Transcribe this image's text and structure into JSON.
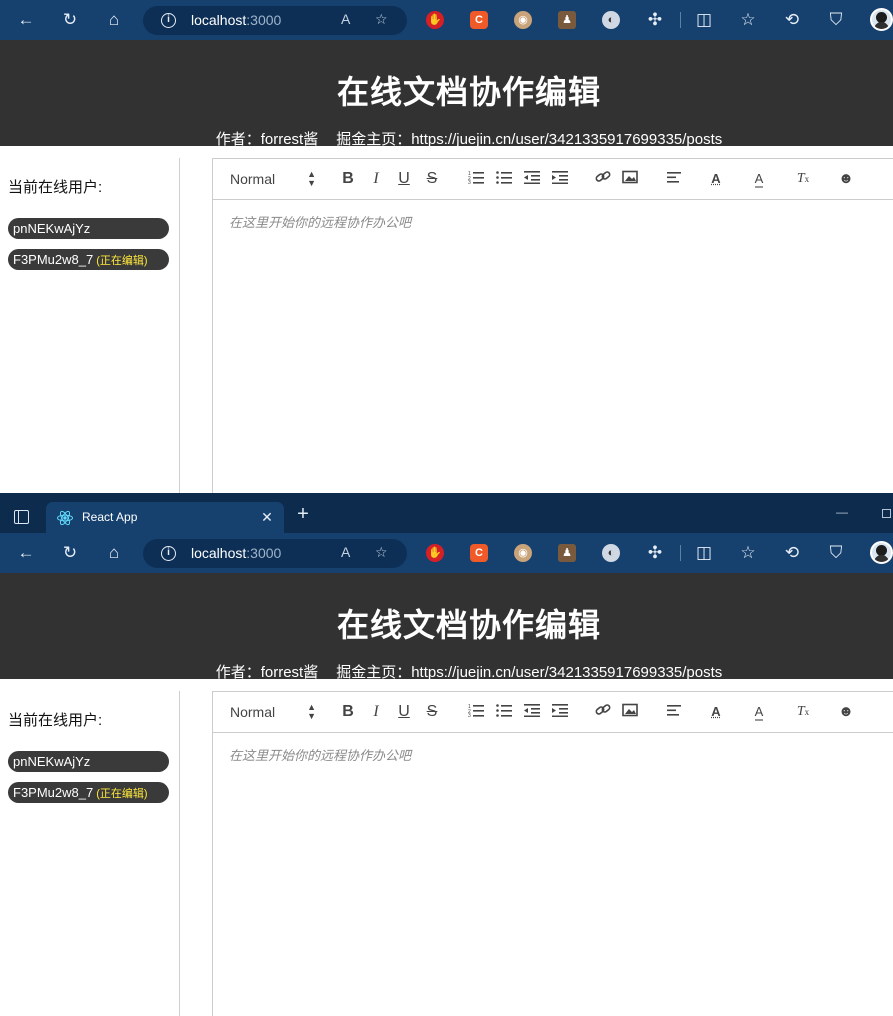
{
  "browser": {
    "tab_title": "React App",
    "tab_close": "✕",
    "new_tab": "+",
    "window_minimize": "—",
    "url_host": "localhost",
    "url_port": ":3000",
    "address_info": "i",
    "colors": {
      "tabbar": "#0c2b4d",
      "navbar": "#16416f",
      "address": "#0d2f55"
    }
  },
  "page": {
    "title": "在线文档协作编辑",
    "author": "作者：forrest酱",
    "homepage": "掘金主页：https://juejin.cn/user/3421335917699335/posts",
    "sidebar_title": "当前在线用户:",
    "users": [
      {
        "name": "pnNEKwAjYz",
        "tag": ""
      },
      {
        "name": "F3PMu2w8_7",
        "tag": "(正在编辑)"
      }
    ],
    "editor": {
      "format_select": "Normal",
      "placeholder": "在这里开始你的远程协作办公吧"
    },
    "colors": {
      "header": "#323232",
      "pill": "#3a3a3a",
      "editing_tag": "#ffe93a"
    }
  }
}
